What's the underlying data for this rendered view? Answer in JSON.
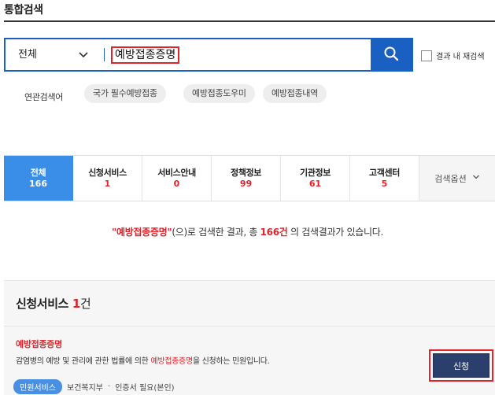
{
  "header": {
    "title": "통합검색"
  },
  "search": {
    "scope": "전체",
    "query": "예방접종증명",
    "refine_label": "결과 내 재검색",
    "accent_color": "#1a5fc2",
    "icons": {
      "scope_toggle": "chevron-down-icon",
      "submit": "search-icon",
      "refine": "checkbox-icon"
    }
  },
  "related": {
    "label": "연관검색어",
    "keywords": [
      "국가 필수예방접종",
      "예방접종도우미",
      "예방접종내역"
    ]
  },
  "tabs": [
    {
      "label": "전체",
      "count": "166",
      "active": true
    },
    {
      "label": "신청서비스",
      "count": "1"
    },
    {
      "label": "서비스안내",
      "count": "0"
    },
    {
      "label": "정책정보",
      "count": "99"
    },
    {
      "label": "기관정보",
      "count": "61"
    },
    {
      "label": "고객센터",
      "count": "5"
    }
  ],
  "search_options": {
    "label": "검색옵션",
    "icon": "chevron-down-icon"
  },
  "summary": {
    "quote_open": "\"",
    "keyword": "예방접종증명",
    "quote_close": "\"",
    "mid": "(으)로 검색한 결과, 총 ",
    "total": "166건",
    "tail": " 의 검색결과가 있습니다."
  },
  "section": {
    "title": "신청서비스",
    "count": "1",
    "unit": "건",
    "item": {
      "title": "예방접종증명",
      "desc_before": "감염병의 예방 및 관리에 관한 법률에 의한 ",
      "desc_highlight": "예방접종증명",
      "desc_after": "을 신청하는 민원입니다.",
      "badge": "민원서비스",
      "agency": "보건복지부",
      "separator": "·",
      "requirement": "인증서 필요(본인)",
      "apply_label": "신청"
    }
  },
  "colors": {
    "highlight": "#e0242b",
    "active_tab": "#3b8ee8",
    "apply_button": "#2a3f6b"
  }
}
